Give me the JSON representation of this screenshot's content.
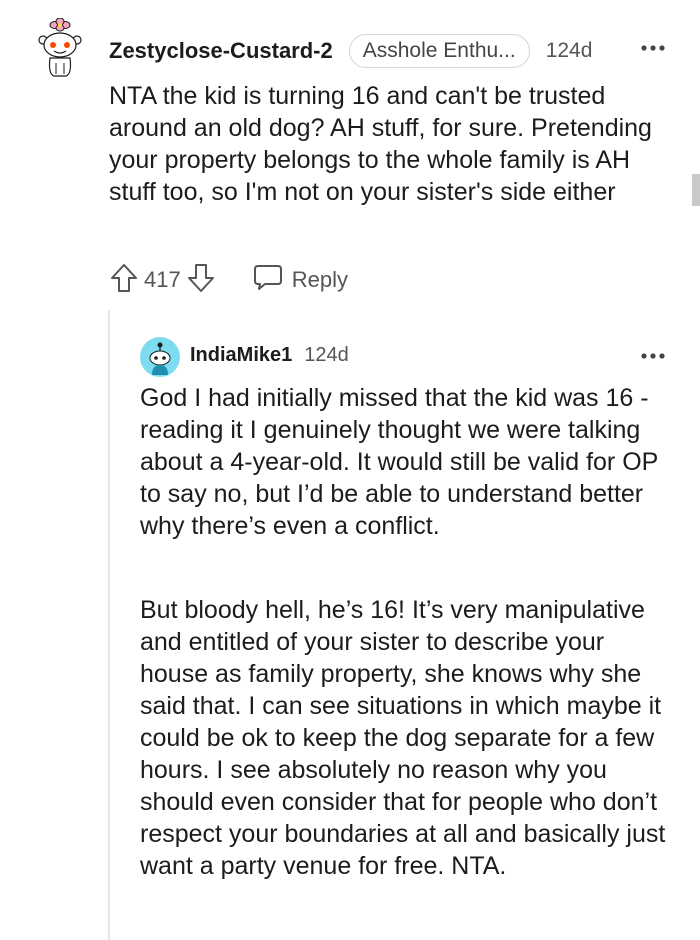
{
  "comment": {
    "username": "Zestyclose-Custard-2",
    "flair": "Asshole Enthu...",
    "age": "124d",
    "avatar_icon": "snoo-avatar-with-flower-icon",
    "body": "NTA the kid is turning 16 and can't be trusted around an old dog? AH stuff, for sure. Pretending your property belongs to the whole family is AH stuff too, so I'm not on your sister's side either",
    "vote_count": "417",
    "reply_label": "Reply"
  },
  "reply": {
    "username": "IndiaMike1",
    "age": "124d",
    "avatar_icon": "snoo-avatar-teal-icon",
    "avatar_color": "#7ddcf0",
    "paragraphs": [
      "God I had initially missed that the kid was 16 - reading it I genuinely thought we were talking about a 4-year-old. It would still be valid for OP to say no, but I’d be able to understand better why there’s even a conflict.",
      "But bloody hell, he’s 16! It’s very manipulative and entitled of your sister to describe your house as family property, she knows why she said that. I can see situations in which maybe it could be ok to keep the dog separate for a few hours. I see absolutely no reason why you should even consider that for people who don’t respect your boundaries at all and basically just want a party venue for free. NTA."
    ]
  },
  "colors": {
    "text": "#1c1c1c",
    "meta": "#555555",
    "thread_line": "#e6e6e6",
    "flair_border": "#d0d4d8"
  }
}
